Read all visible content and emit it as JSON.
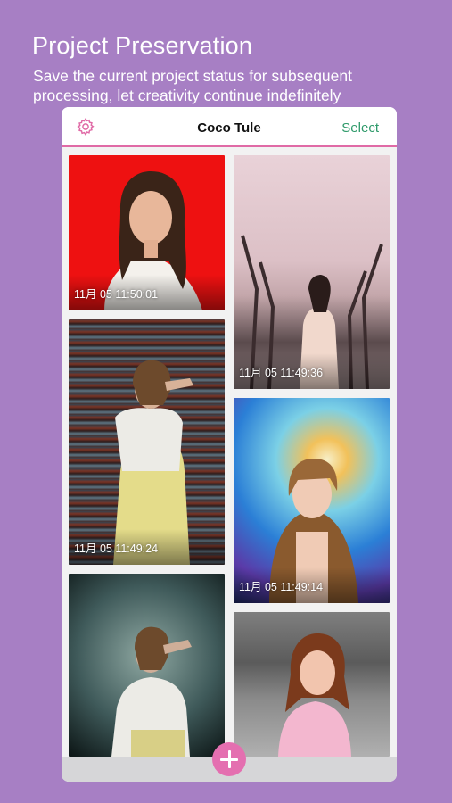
{
  "promo": {
    "headline": "Project Preservation",
    "subline": "Save the current project status for subsequent processing, let creativity continue indefinitely"
  },
  "navbar": {
    "settings_icon": "gear-icon",
    "title": "Coco Tule",
    "select_label": "Select"
  },
  "projects": [
    {
      "timestamp": "11月 05 11:50:01",
      "thumbnail": "woman-red-backdrop"
    },
    {
      "timestamp": "11月 05 11:49:36",
      "thumbnail": "woman-cherry-blossom-avenue"
    },
    {
      "timestamp": "11月 05 11:49:24",
      "thumbnail": "glitch-effect-portrait"
    },
    {
      "timestamp": "11月 05 11:49:14",
      "thumbnail": "prism-light-portrait"
    },
    {
      "timestamp": "",
      "thumbnail": "vignette-noise-portrait"
    },
    {
      "timestamp": "",
      "thumbnail": "woman-pink-dress-grayscale-bg"
    }
  ],
  "fab": {
    "icon": "plus-icon"
  },
  "colors": {
    "background": "#a77fc4",
    "accent_pink": "#e06aa6",
    "select_green": "#2e9a6a"
  }
}
